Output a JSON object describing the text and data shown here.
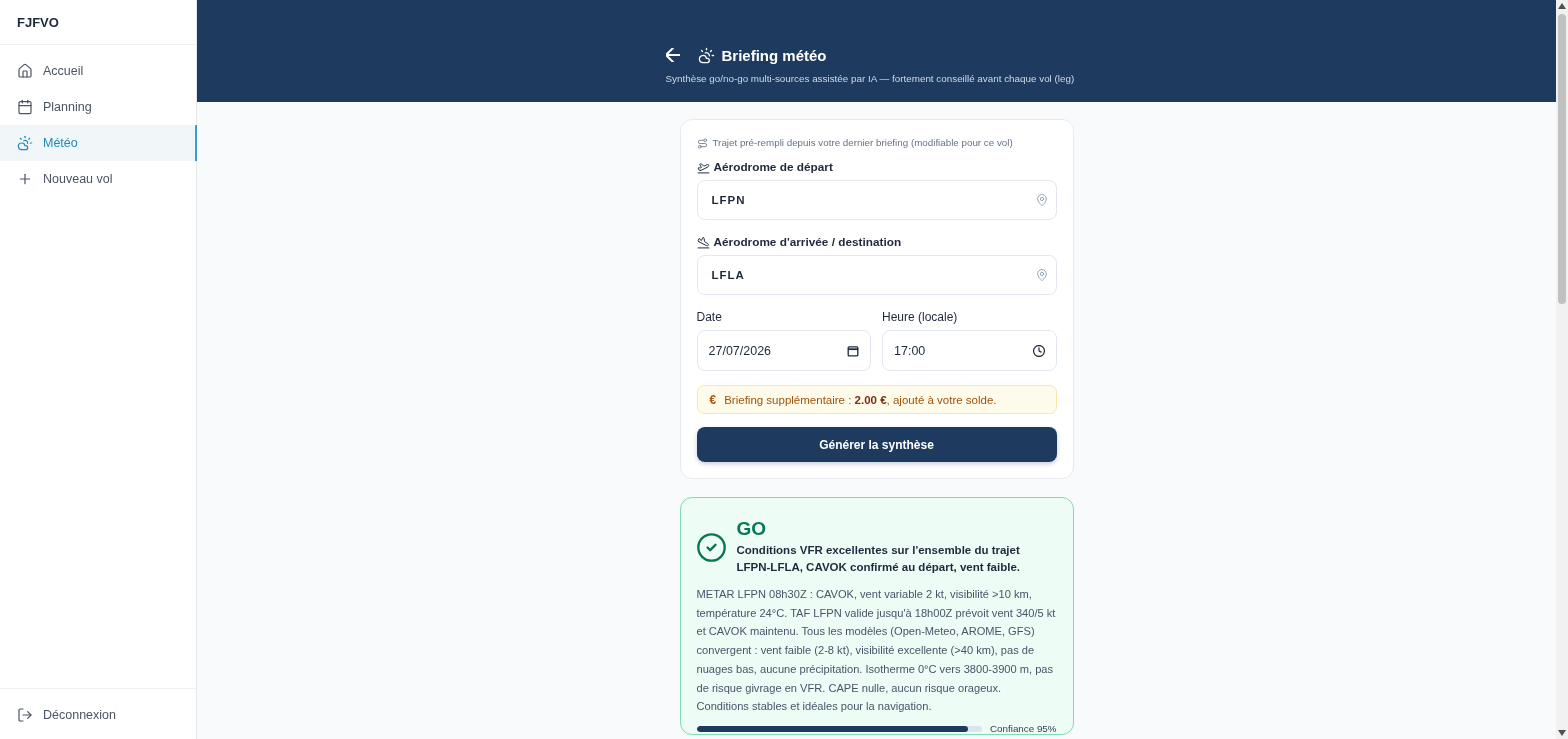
{
  "sidebar": {
    "brand": "FJFVO",
    "items": [
      {
        "label": "Accueil",
        "selected": false
      },
      {
        "label": "Planning",
        "selected": false
      },
      {
        "label": "Météo",
        "selected": true
      },
      {
        "label": "Nouveau vol",
        "selected": false
      }
    ],
    "logout": "Déconnexion"
  },
  "header": {
    "title": "Briefing météo",
    "subtitle": "Synthèse go/no-go multi-sources assistée par IA — fortement conseillé avant chaque vol (leg)"
  },
  "form": {
    "hint": "Trajet pré-rempli depuis votre dernier briefing (modifiable pour ce vol)",
    "airports": [
      {
        "label": "Aérodrome de départ",
        "value": "LFPN"
      },
      {
        "label": "Aérodrome d'arrivée / destination",
        "value": "LFLA"
      }
    ],
    "date": {
      "label": "Date",
      "value": "27/07/2026"
    },
    "time": {
      "label": "Heure (locale)",
      "value": "17:00"
    },
    "notice": {
      "symbol": "€",
      "text": "Briefing supplémentaire : **2.00 €**, ajouté à votre solde."
    },
    "submit": "Générer la synthèse"
  },
  "result": {
    "kind": "go",
    "verdict": "GO",
    "summary": "Conditions VFR excellentes sur l'ensemble du trajet LFPN-LFLA, CAVOK confirmé au départ, vent faible.",
    "details": "METAR LFPN 08h30Z : CAVOK, vent variable 2 kt, visibilité >10 km, température 24°C. TAF LFPN valide jusqu'à 18h00Z prévoit vent 340/5 kt et CAVOK maintenu. Tous les modèles (Open-Meteo, AROME, GFS) convergent : vent faible (2-8 kt), visibilité excellente (>40 km), pas de nuages bas, aucune précipitation. Isotherme 0°C vers 3800-3900 m, pas de risque givrage en VFR. CAPE nulle, aucun risque orageux. Conditions stables et idéales pour la navigation.",
    "confidence": {
      "level": 0.95,
      "label": "Confiance 95%"
    }
  }
}
